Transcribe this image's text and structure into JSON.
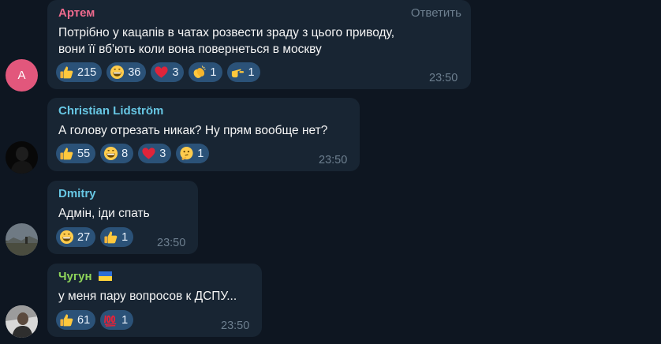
{
  "messages": [
    {
      "author": "Артем",
      "author_color": "#ee6a8d",
      "reply_label": "Ответить",
      "lines": [
        "Потрібно у кацапів в чатах розвести зраду з цього приводу,",
        "вони її вб'ють коли вона повернеться в москву"
      ],
      "avatar_letter": "A",
      "avatar_color": "#e2577c",
      "reactions": [
        {
          "icon": "thumbs-up-icon",
          "count": "215"
        },
        {
          "icon": "grinning-face-icon",
          "count": "36"
        },
        {
          "icon": "red-heart-icon",
          "count": "3"
        },
        {
          "icon": "clapping-hands-icon",
          "count": "1"
        },
        {
          "icon": "pointing-hand-icon",
          "count": "1"
        }
      ],
      "time": "23:50"
    },
    {
      "author": "Christian Lidström",
      "author_color": "#67c6e3",
      "lines": [
        "А голову отрезать никак? Ну прям вообще нет?"
      ],
      "reactions": [
        {
          "icon": "thumbs-up-icon",
          "count": "55"
        },
        {
          "icon": "grinning-face-icon",
          "count": "8"
        },
        {
          "icon": "red-heart-icon",
          "count": "3"
        },
        {
          "icon": "thinking-face-icon",
          "count": "1"
        }
      ],
      "time": "23:50"
    },
    {
      "author": "Dmitry",
      "author_color": "#67c6e3",
      "lines": [
        "Адмін, іди спать"
      ],
      "reactions": [
        {
          "icon": "grinning-face-icon",
          "count": "27"
        },
        {
          "icon": "thumbs-up-icon",
          "count": "1"
        }
      ],
      "time": "23:50"
    },
    {
      "author": "Чугун",
      "author_color": "#8ed45a",
      "author_badge": "ukraine-flag-icon",
      "lines": [
        "у меня пару вопросов к ДСПУ..."
      ],
      "reactions": [
        {
          "icon": "thumbs-up-icon",
          "count": "61"
        },
        {
          "icon": "hundred-points-icon",
          "count": "1"
        }
      ],
      "time": "23:50"
    }
  ]
}
